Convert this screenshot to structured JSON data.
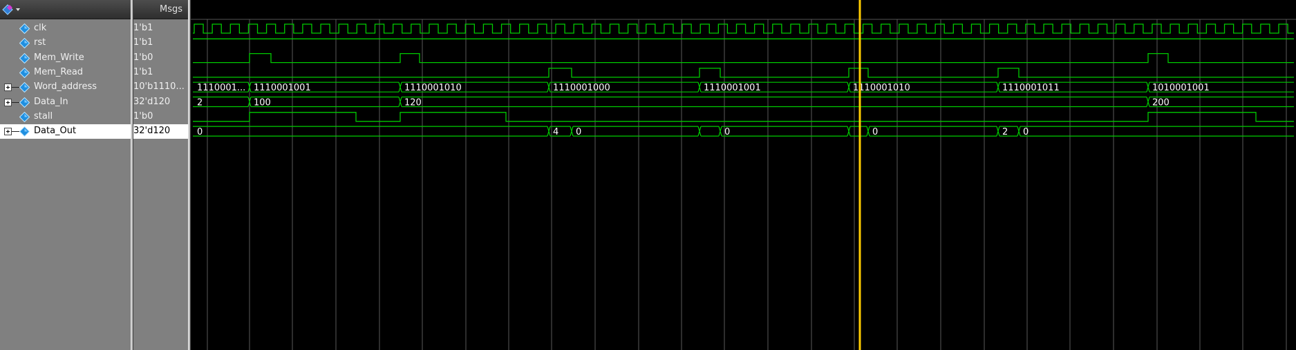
{
  "header": {
    "msgs_label": "Msgs"
  },
  "colors": {
    "wave": "#00cc00",
    "cursor": "#ffcc00",
    "grid": "#5a5a5a"
  },
  "signals": [
    {
      "name": "clk",
      "value": "1'b1",
      "expandable": false
    },
    {
      "name": "rst",
      "value": "1'b1",
      "expandable": false
    },
    {
      "name": "Mem_Write",
      "value": "1'b0",
      "expandable": false
    },
    {
      "name": "Mem_Read",
      "value": "1'b1",
      "expandable": false
    },
    {
      "name": "Word_address",
      "value": "10'b1110...",
      "expandable": true
    },
    {
      "name": "Data_In",
      "value": "32'd120",
      "expandable": true
    },
    {
      "name": "stall",
      "value": "1'b0",
      "expandable": false
    },
    {
      "name": "Data_Out",
      "value": "32'd120",
      "expandable": true,
      "selected": true
    }
  ],
  "bus_values": {
    "word_address": [
      "1110001...",
      "1110001001",
      "1110001010",
      "1110001000",
      "1110001001",
      "1110001010",
      "1110001011",
      "1010001001"
    ],
    "data_in": [
      "2",
      "100",
      "120",
      "200"
    ],
    "data_out": [
      "0",
      "4",
      "0",
      "0",
      "0",
      "2",
      "0"
    ]
  }
}
